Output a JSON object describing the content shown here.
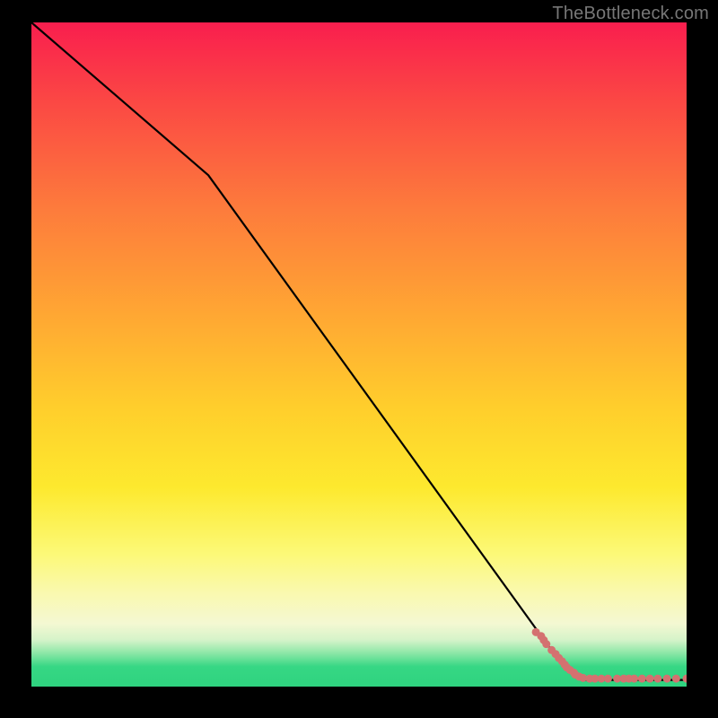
{
  "watermark": "TheBottleneck.com",
  "chart_data": {
    "type": "line",
    "title": "",
    "xlabel": "",
    "ylabel": "",
    "xlim": [
      0,
      100
    ],
    "ylim": [
      0,
      100
    ],
    "line": {
      "x": [
        0,
        27,
        79,
        84,
        100
      ],
      "y": [
        100,
        77,
        6,
        1,
        1
      ]
    },
    "scatter": {
      "x": [
        77.0,
        77.8,
        78.2,
        78.6,
        79.4,
        80.0,
        80.5,
        81.0,
        81.4,
        81.7,
        82.2,
        82.8,
        83.0,
        83.6,
        84.2,
        85.2,
        86.0,
        87.0,
        88.0,
        89.4,
        90.4,
        91.2,
        92.0,
        93.2,
        94.4,
        95.6,
        97.0,
        98.4,
        100.0
      ],
      "y": [
        8.2,
        7.6,
        7.0,
        6.4,
        5.5,
        4.9,
        4.3,
        3.8,
        3.3,
        2.9,
        2.5,
        2.1,
        1.8,
        1.5,
        1.3,
        1.2,
        1.2,
        1.2,
        1.2,
        1.2,
        1.2,
        1.2,
        1.2,
        1.2,
        1.2,
        1.2,
        1.2,
        1.2,
        1.2
      ],
      "color": "#d47170",
      "radius_px": 4.5
    },
    "grid": false,
    "legend": null
  }
}
